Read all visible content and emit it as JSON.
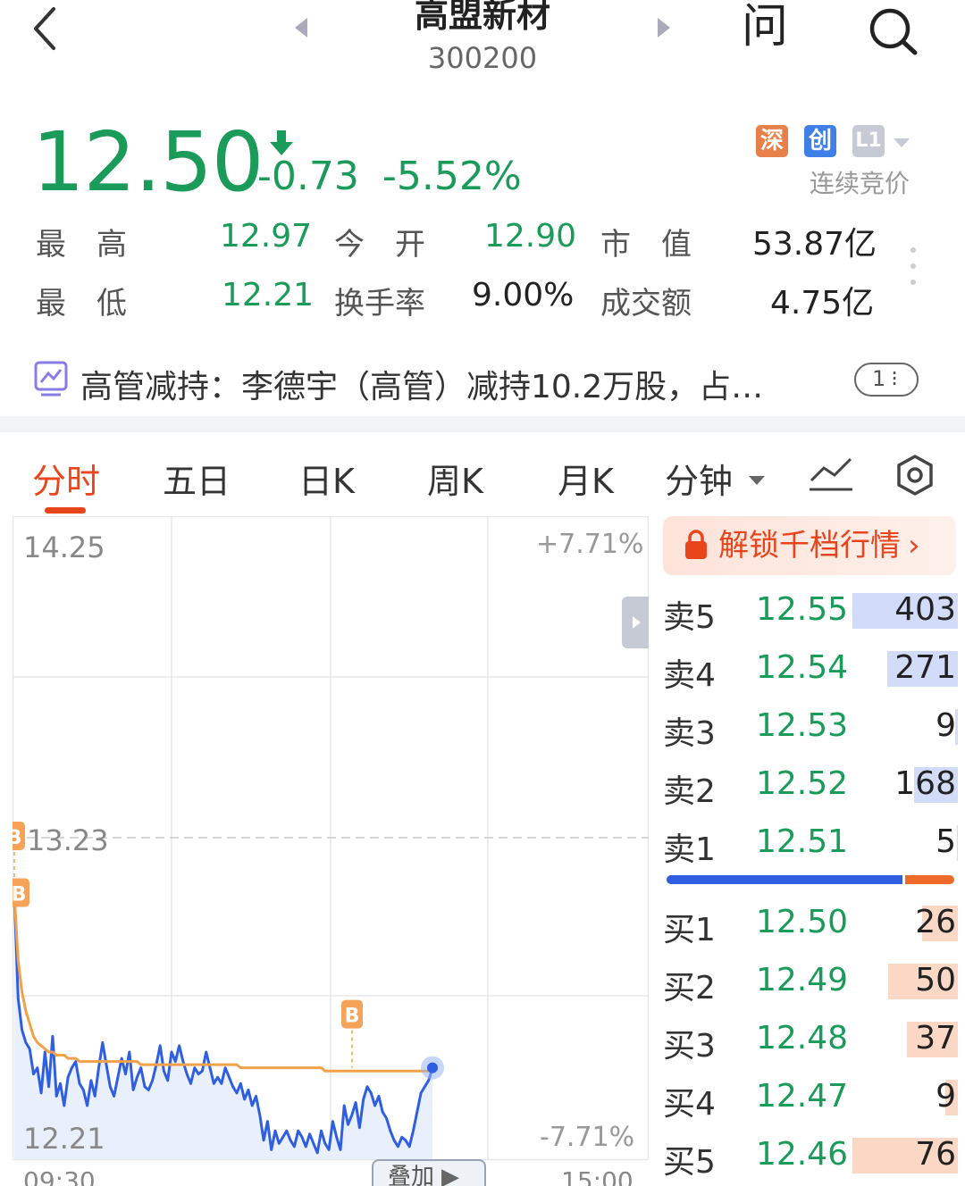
{
  "header": {
    "title": "高盟新材",
    "code": "300200",
    "ask_icon_label": "问"
  },
  "quote": {
    "price": "12.50",
    "change": "-0.73",
    "change_pct": "-5.52%",
    "badges": [
      "深",
      "创",
      "L1"
    ],
    "auction_label": "连续竞价",
    "colors": {
      "down": "#1a9b5a",
      "up": "#e8451c"
    }
  },
  "stats": {
    "high_label": "最　高",
    "high": "12.97",
    "open_label": "今　开",
    "open": "12.90",
    "mktcap_label": "市　值",
    "mktcap": "53.87亿",
    "low_label": "最　低",
    "low": "12.21",
    "turnover_label": "换手率",
    "turnover": "9.00%",
    "amount_label": "成交额",
    "amount": "4.75亿"
  },
  "news": {
    "text": "高管减持：李德宇（高管）减持10.2万股，占…",
    "pager": "1"
  },
  "tabs": [
    "分时",
    "五日",
    "日K",
    "周K",
    "月K",
    "分钟"
  ],
  "chart_data": {
    "type": "line",
    "y_top": "14.25",
    "y_mid": "13.23",
    "y_bottom": "12.21",
    "pct_top": "+7.71%",
    "pct_bottom": "-7.71%",
    "x_start": "09:30",
    "x_end": "15:00",
    "overlay_label": "叠加",
    "ylim": [
      12.21,
      14.25
    ],
    "prev_close": 13.23,
    "marker_label": "B",
    "price_series": [
      13.05,
      12.72,
      12.62,
      12.58,
      12.56,
      12.48,
      12.5,
      12.42,
      12.55,
      12.44,
      12.6,
      12.41,
      12.45,
      12.38,
      12.47,
      12.5,
      12.52,
      12.45,
      12.43,
      12.38,
      12.46,
      12.41,
      12.5,
      12.58,
      12.51,
      12.44,
      12.41,
      12.47,
      12.53,
      12.48,
      12.55,
      12.43,
      12.47,
      12.5,
      12.44,
      12.43,
      12.46,
      12.51,
      12.57,
      12.49,
      12.46,
      12.55,
      12.52,
      12.57,
      12.52,
      12.48,
      12.45,
      12.5,
      12.48,
      12.49,
      12.55,
      12.5,
      12.45,
      12.47,
      12.45,
      12.5,
      12.47,
      12.44,
      12.42,
      12.45,
      12.4,
      12.43,
      12.38,
      12.41,
      12.35,
      12.27,
      12.33,
      12.24,
      12.3,
      12.26,
      12.28,
      12.3,
      12.27,
      12.25,
      12.3,
      12.28,
      12.25,
      12.29,
      12.26,
      12.23,
      12.3,
      12.26,
      12.24,
      12.33,
      12.28,
      12.24,
      12.38,
      12.32,
      12.35,
      12.39,
      12.31,
      12.4,
      12.44,
      12.42,
      12.38,
      12.41,
      12.36,
      12.34,
      12.3,
      12.27,
      12.25,
      12.28,
      12.27,
      12.25,
      12.3,
      12.36,
      12.42,
      12.44,
      12.46,
      12.5
    ],
    "avg_series": [
      13.05,
      12.84,
      12.74,
      12.68,
      12.64,
      12.6,
      12.58,
      12.57,
      12.56,
      12.55,
      12.55,
      12.54,
      12.54,
      12.54,
      12.53,
      12.53,
      12.53,
      12.52,
      12.52,
      12.52,
      12.52,
      12.52,
      12.52,
      12.52,
      12.52,
      12.52,
      12.52,
      12.52,
      12.52,
      12.52,
      12.52,
      12.52,
      12.52,
      12.51,
      12.51,
      12.51,
      12.51,
      12.51,
      12.51,
      12.51,
      12.51,
      12.51,
      12.51,
      12.51,
      12.51,
      12.51,
      12.51,
      12.51,
      12.51,
      12.51,
      12.51,
      12.51,
      12.51,
      12.51,
      12.51,
      12.51,
      12.51,
      12.51,
      12.51,
      12.5,
      12.5,
      12.5,
      12.5,
      12.5,
      12.5,
      12.5,
      12.5,
      12.5,
      12.5,
      12.5,
      12.5,
      12.5,
      12.5,
      12.5,
      12.5,
      12.5,
      12.5,
      12.5,
      12.5,
      12.5,
      12.5,
      12.49,
      12.49,
      12.49,
      12.49,
      12.49,
      12.49,
      12.49,
      12.49,
      12.49,
      12.49,
      12.49,
      12.49,
      12.49,
      12.49,
      12.49,
      12.49,
      12.49,
      12.49,
      12.49,
      12.49,
      12.49,
      12.49,
      12.49,
      12.49,
      12.49,
      12.49,
      12.49,
      12.49,
      12.49
    ]
  },
  "orderbook": {
    "unlock_label": "解锁千档行情",
    "sells": [
      {
        "label": "卖5",
        "price": "12.55",
        "vol": "403",
        "vol_num": 403
      },
      {
        "label": "卖4",
        "price": "12.54",
        "vol": "271",
        "vol_num": 271
      },
      {
        "label": "卖3",
        "price": "12.53",
        "vol": "9",
        "vol_num": 9
      },
      {
        "label": "卖2",
        "price": "12.52",
        "vol": "168",
        "vol_num": 168
      },
      {
        "label": "卖1",
        "price": "12.51",
        "vol": "5",
        "vol_num": 5
      }
    ],
    "buys": [
      {
        "label": "买1",
        "price": "12.50",
        "vol": "26",
        "vol_num": 26
      },
      {
        "label": "买2",
        "price": "12.49",
        "vol": "50",
        "vol_num": 50
      },
      {
        "label": "买3",
        "price": "12.48",
        "vol": "37",
        "vol_num": 37
      },
      {
        "label": "买4",
        "price": "12.47",
        "vol": "9",
        "vol_num": 9
      },
      {
        "label": "买5",
        "price": "12.46",
        "vol": "76",
        "vol_num": 76
      }
    ],
    "ratio_buy_fraction": 0.83
  }
}
